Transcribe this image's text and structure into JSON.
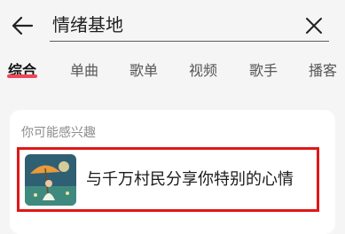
{
  "search": {
    "query": "情绪基地"
  },
  "tabs": [
    {
      "label": "综合",
      "active": true
    },
    {
      "label": "单曲"
    },
    {
      "label": "歌单"
    },
    {
      "label": "视频"
    },
    {
      "label": "歌手"
    },
    {
      "label": "播客"
    }
  ],
  "suggestions": {
    "title": "你可能感兴趣",
    "item": {
      "title": "与千万村民分享你特别的心情"
    }
  },
  "colors": {
    "accent": "#f1465a",
    "highlight_border": "#e01717"
  },
  "icons": {
    "back": "back-arrow-icon",
    "clear": "close-icon"
  }
}
